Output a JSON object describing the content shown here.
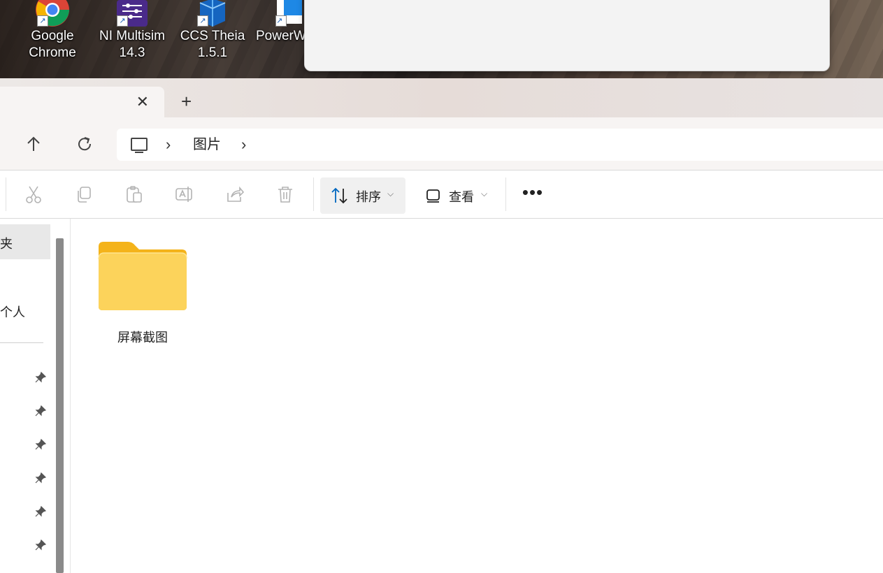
{
  "desktop": {
    "icons": [
      {
        "label": "Google\nChrome",
        "icon": "chrome-icon"
      },
      {
        "label": "NI Multisim\n14.3",
        "icon": "multisim-icon"
      },
      {
        "label": "CCS Theia\n1.5.1",
        "icon": "ccs-theia-icon"
      },
      {
        "label": "PowerW",
        "icon": "powerw-icon"
      }
    ]
  },
  "tabs": {
    "close_symbol": "✕",
    "new_tab_symbol": "+"
  },
  "nav": {
    "up_symbol": "↑",
    "refresh_symbol": "↻",
    "breadcrumb": [
      "图片"
    ]
  },
  "toolbar": {
    "sort_label": "排序",
    "view_label": "查看",
    "more_symbol": "•••",
    "dropdown_symbol": "⌵"
  },
  "sidebar": {
    "selected_label": "夹",
    "second_label": "个人",
    "pinned_count": 6
  },
  "content": {
    "items": [
      {
        "name": "屏幕截图",
        "type": "folder"
      }
    ]
  },
  "colors": {
    "folder_back": "#f6b91a",
    "folder_front": "#fcd55a",
    "accent": "#0067c0"
  }
}
